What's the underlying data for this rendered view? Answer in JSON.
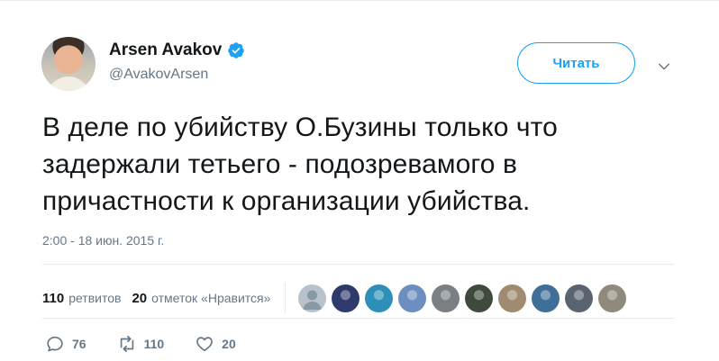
{
  "author": {
    "display_name": "Arsen Avakov",
    "handle": "@AvakovArsen",
    "verified": true
  },
  "follow_button": {
    "label": "Читать"
  },
  "tweet": {
    "text": "В деле по убийству О.Бузины только что задержали тетьего - подозревамого в причастности к организации убийства.",
    "timestamp": "2:00 - 18 июн. 2015 г."
  },
  "stats": {
    "retweets_count": "110",
    "retweets_label": "ретвитов",
    "likes_count": "20",
    "likes_label": "отметок «Нравится»"
  },
  "likers": [
    {
      "icon": "default-avatar",
      "color": "#b7c2cc"
    },
    {
      "icon": "user-photo",
      "color": "#2e3a6b"
    },
    {
      "icon": "user-photo",
      "color": "#2e8fb8"
    },
    {
      "icon": "user-photo",
      "color": "#6d8fbf"
    },
    {
      "icon": "user-photo",
      "color": "#7a7f83"
    },
    {
      "icon": "user-photo",
      "color": "#3d4a3c"
    },
    {
      "icon": "user-photo",
      "color": "#a08a70"
    },
    {
      "icon": "user-photo",
      "color": "#3f6f99"
    },
    {
      "icon": "user-photo",
      "color": "#5a6470"
    },
    {
      "icon": "user-photo",
      "color": "#8f8a7c"
    }
  ],
  "actions": {
    "reply_count": "76",
    "retweet_count": "110",
    "like_count": "20"
  },
  "colors": {
    "accent": "#1da1f2",
    "secondary_text": "#657786",
    "primary_text": "#14171a",
    "divider": "#e6ecf0"
  }
}
